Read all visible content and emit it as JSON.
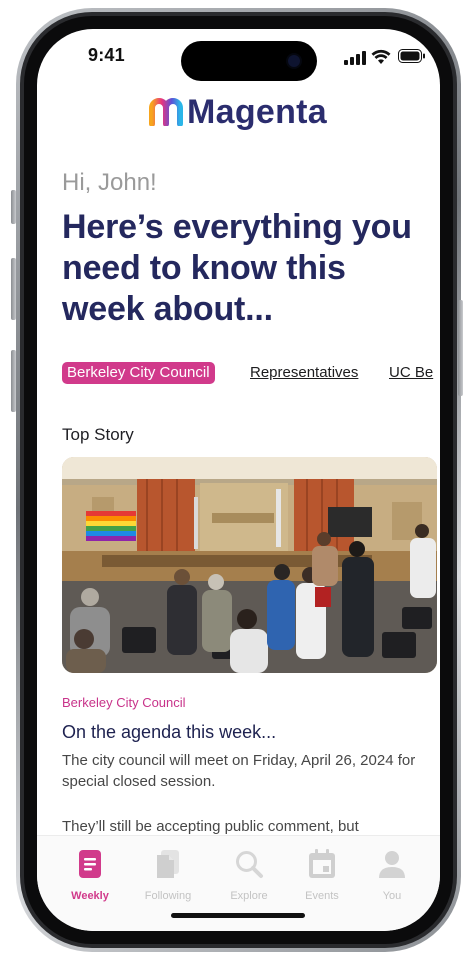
{
  "status_bar": {
    "time": "9:41"
  },
  "header": {
    "brand": "Magenta"
  },
  "greeting": "Hi, John!",
  "headline": "Here’s everything you need to know this week about...",
  "topic_tabs": [
    {
      "label": "Berkeley City Council",
      "active": true
    },
    {
      "label": "Representatives",
      "active": false
    },
    {
      "label": "UC Be",
      "active": false
    }
  ],
  "top_story": {
    "section_label": "Top Story",
    "kicker": "Berkeley City Council",
    "title": "On the agenda this week...",
    "body": "The city council will meet on Friday, April 26, 2024 for special closed session.",
    "body_more": "They’ll still be accepting public comment, but"
  },
  "tab_bar": {
    "items": [
      {
        "label": "Weekly",
        "icon": "document-icon",
        "active": true
      },
      {
        "label": "Following",
        "icon": "pages-icon",
        "active": false
      },
      {
        "label": "Explore",
        "icon": "search-icon",
        "active": false
      },
      {
        "label": "Events",
        "icon": "calendar-icon",
        "active": false
      },
      {
        "label": "You",
        "icon": "person-icon",
        "active": false
      }
    ]
  },
  "colors": {
    "accent": "#d13a8b",
    "headline": "#24285e",
    "brand_text": "#2b2d6e"
  }
}
